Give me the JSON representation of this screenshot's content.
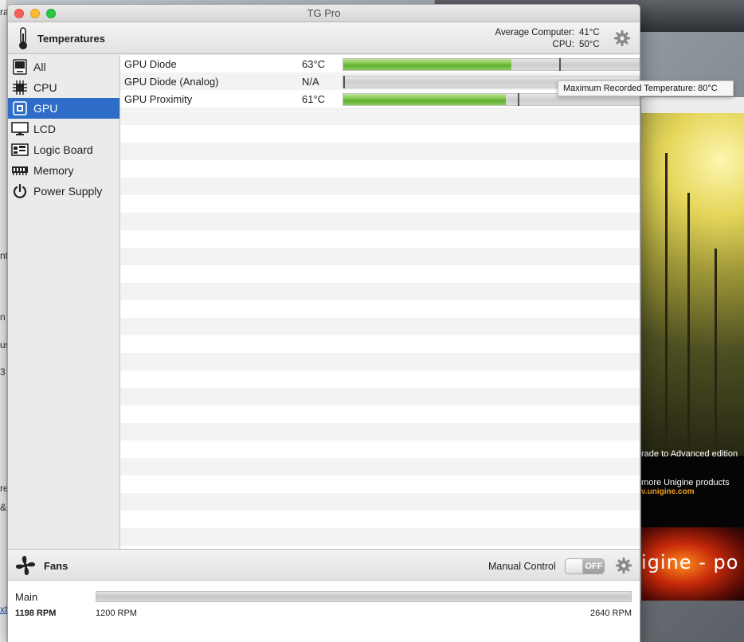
{
  "window": {
    "title": "TG Pro"
  },
  "temperatures": {
    "title": "Temperatures",
    "average_label": "Average Computer:",
    "average_value": "41°C",
    "cpu_label": "CPU:",
    "cpu_value": "50°C"
  },
  "sidebar": {
    "items": [
      {
        "label": "All",
        "icon": "computer-icon",
        "selected": false
      },
      {
        "label": "CPU",
        "icon": "cpu-chip-icon",
        "selected": false
      },
      {
        "label": "GPU",
        "icon": "gpu-chip-icon",
        "selected": true
      },
      {
        "label": "LCD",
        "icon": "monitor-icon",
        "selected": false
      },
      {
        "label": "Logic Board",
        "icon": "logic-board-icon",
        "selected": false
      },
      {
        "label": "Memory",
        "icon": "memory-icon",
        "selected": false
      },
      {
        "label": "Power Supply",
        "icon": "power-icon",
        "selected": false
      }
    ]
  },
  "sensors": [
    {
      "name": "GPU Diode",
      "value": "63°C",
      "fill_fraction": 0.57,
      "max_marker_fraction": 0.73
    },
    {
      "name": "GPU Diode (Analog)",
      "value": "N/A",
      "fill_fraction": 0,
      "max_marker_fraction": 0.0
    },
    {
      "name": "GPU Proximity",
      "value": "61°C",
      "fill_fraction": 0.55,
      "max_marker_fraction": 0.59
    }
  ],
  "tooltip": {
    "text": "Maximum Recorded Temperature: 80°C"
  },
  "fans": {
    "title": "Fans",
    "manual_label": "Manual Control",
    "toggle_state": "OFF",
    "items": [
      {
        "name": "Main",
        "current_rpm": "1198 RPM",
        "min_rpm": "1200 RPM",
        "max_rpm": "2640 RPM"
      }
    ]
  },
  "background": {
    "right_window_line1": "rade to Advanced edition",
    "right_window_line2": "more Unigine products",
    "right_window_link": "v.unigine.com",
    "right_window_banner": "igine - po",
    "left_fragments": [
      "ra",
      "nt",
      "n",
      "us",
      "3",
      "re",
      "&",
      "xt"
    ]
  },
  "colors": {
    "selection": "#2d6cc7",
    "bar_green": "#7cc445",
    "link_orange": "#f0a020"
  }
}
